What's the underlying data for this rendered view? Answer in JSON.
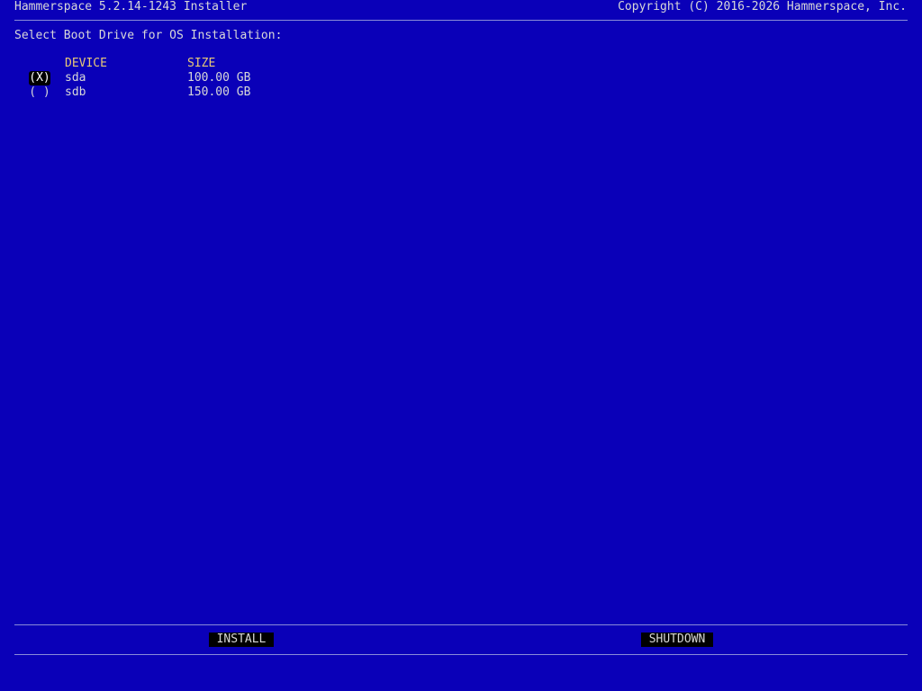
{
  "header": {
    "title": "Hammerspace 5.2.14-1243 Installer",
    "copyright": "Copyright (C) 2016-2026 Hammerspace, Inc."
  },
  "prompt": "Select Boot Drive for OS Installation:",
  "table": {
    "columns": [
      "DEVICE",
      "SIZE"
    ],
    "rows": [
      {
        "selected_mark": "(X)",
        "device": "sda",
        "size": "100.00 GB",
        "selected": true
      },
      {
        "selected_mark": "( )",
        "device": "sdb",
        "size": "150.00 GB",
        "selected": false
      }
    ]
  },
  "footer": {
    "install_label": "INSTALL",
    "shutdown_label": "SHUTDOWN"
  },
  "colors": {
    "background": "#0a00b8",
    "text": "#d8d8d8",
    "header_text": "#e8c878",
    "highlight": "#000000"
  }
}
